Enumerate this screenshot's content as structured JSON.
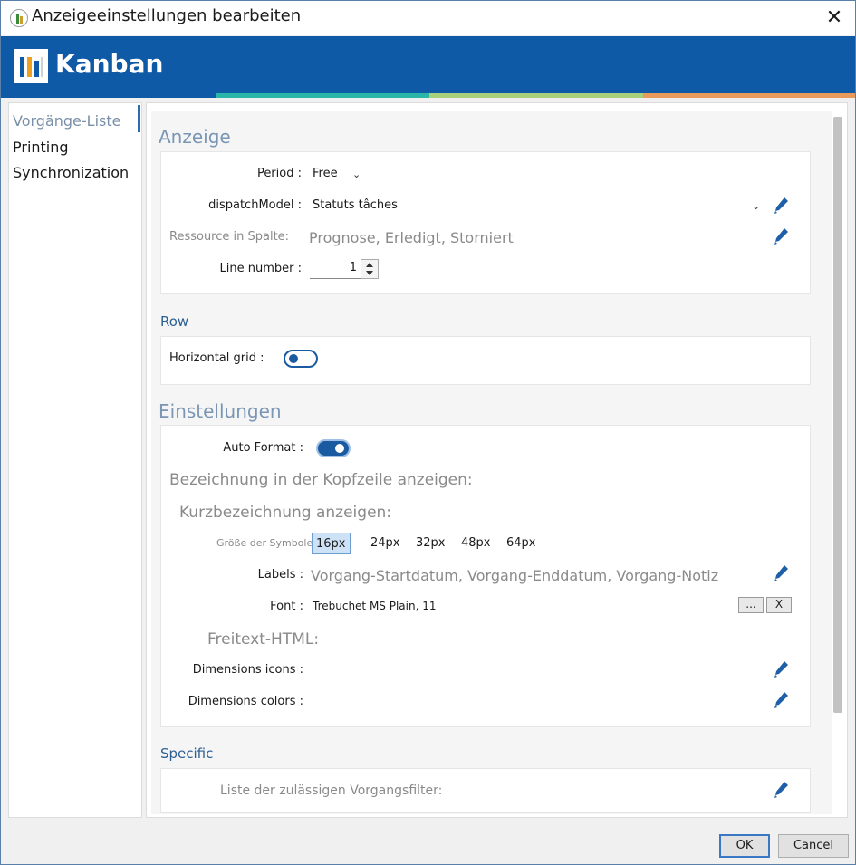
{
  "window": {
    "title": "Anzeigeeinstellungen bearbeiten"
  },
  "banner": {
    "title": "Kanban"
  },
  "colors": {
    "accent": "#0e5aa7",
    "stripe_teal": "#2bb5a8",
    "stripe_green": "#a8d07a",
    "stripe_orange": "#e89a5a"
  },
  "sidebar": {
    "items": [
      {
        "label": "Vorgänge-Liste",
        "active": true
      },
      {
        "label": "Printing",
        "active": false
      },
      {
        "label": "Synchronization",
        "active": false
      }
    ]
  },
  "anzeige": {
    "title": "Anzeige",
    "period_label": "Period :",
    "period_value": "Free",
    "dispatch_label": "dispatchModel :",
    "dispatch_value": "Statuts tâches",
    "ressource_label": "Ressource in Spalte:",
    "ressource_value": "Prognose, Erledigt, Storniert",
    "line_label": "Line number :",
    "line_value": "1"
  },
  "row": {
    "title": "Row",
    "grid_label": "Horizontal grid :",
    "grid_on": false
  },
  "einstellungen": {
    "title": "Einstellungen",
    "autoformat_label": "Auto Format :",
    "autoformat_on": true,
    "kopfzeile_label": "Bezeichnung in der Kopfzeile anzeigen:",
    "kurz_label": "Kurzbezeichnung anzeigen:",
    "symbol_label": "Größe der Symbole:",
    "symbol_sizes": [
      "16px",
      "24px",
      "32px",
      "48px",
      "64px"
    ],
    "symbol_selected": "16px",
    "labels_label": "Labels :",
    "labels_value": "Vorgang-Startdatum, Vorgang-Enddatum, Vorgang-Notiz",
    "font_label": "Font :",
    "font_value": "Trebuchet MS Plain, 11",
    "font_browse": "...",
    "font_clear": "X",
    "freitext_label": "Freitext-HTML:",
    "dim_icons_label": "Dimensions icons :",
    "dim_colors_label": "Dimensions colors :"
  },
  "specific": {
    "title": "Specific",
    "filter_label": "Liste der zulässigen Vorgangsfilter:"
  },
  "footer": {
    "ok": "OK",
    "cancel": "Cancel"
  },
  "icons": {
    "close": "close-icon",
    "edit": "pencil-icon",
    "dropdown": "chevron-down-icon"
  }
}
